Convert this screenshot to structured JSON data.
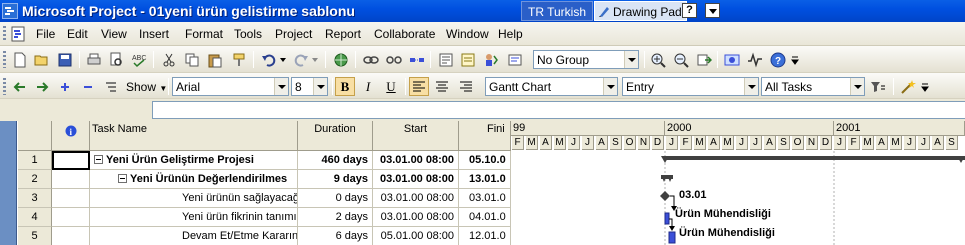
{
  "window": {
    "title": "Microsoft Project - 01yeni ürün gelistirme sablonu",
    "language_indicator": "TR Turkish",
    "drawing_pad": "Drawing Pad",
    "help_symbol": "?"
  },
  "menu": {
    "items": [
      {
        "name": "file",
        "label": "File"
      },
      {
        "name": "edit",
        "label": "Edit"
      },
      {
        "name": "view",
        "label": "View"
      },
      {
        "name": "insert",
        "label": "Insert"
      },
      {
        "name": "format",
        "label": "Format"
      },
      {
        "name": "tools",
        "label": "Tools"
      },
      {
        "name": "project",
        "label": "Project"
      },
      {
        "name": "report",
        "label": "Report"
      },
      {
        "name": "collaborate",
        "label": "Collaborate"
      },
      {
        "name": "window",
        "label": "Window"
      },
      {
        "name": "help",
        "label": "Help"
      }
    ]
  },
  "toolbar1": {
    "group_value": "No Group"
  },
  "toolbar2": {
    "show_label": "Show",
    "font_value": "Arial",
    "size_value": "8",
    "bold": "B",
    "italic": "I",
    "underline": "U",
    "view_value": "Gantt Chart",
    "table_value": "Entry",
    "filter_value": "All Tasks"
  },
  "grid": {
    "headers": {
      "info": "i",
      "task_name": "Task Name",
      "duration": "Duration",
      "start": "Start",
      "finish": "Fini"
    },
    "rows": [
      {
        "id": "1",
        "name": "Yeni Ürün Geliştirme Projesi",
        "duration": "460 days",
        "start": "03.01.00 08:00",
        "finish": "05.10.0",
        "bold": true,
        "indent": 0,
        "summary": true
      },
      {
        "id": "2",
        "name": "Yeni Ürünün Değerlendirilmes",
        "duration": "9 days",
        "start": "03.01.00 08:00",
        "finish": "13.01.0",
        "bold": true,
        "indent": 1,
        "summary": true
      },
      {
        "id": "3",
        "name": "Yeni ürünün sağlayacağı firs",
        "duration": "0 days",
        "start": "03.01.00 08:00",
        "finish": "03.01.0",
        "bold": false,
        "indent": 2,
        "summary": false
      },
      {
        "id": "4",
        "name": "Yeni ürün fikrinin tanımı",
        "duration": "2 days",
        "start": "03.01.00 08:00",
        "finish": "04.01.0",
        "bold": false,
        "indent": 2,
        "summary": false
      },
      {
        "id": "5",
        "name": "Devam Et/Etme  Kararının ver",
        "duration": "6 days",
        "start": "05.01.00 08:00",
        "finish": "12.01.0",
        "bold": false,
        "indent": 2,
        "summary": false
      }
    ]
  },
  "timescale": {
    "years": [
      "99",
      "2000",
      "2001"
    ],
    "months_1999": [
      "F",
      "M",
      "A",
      "M",
      "J",
      "J",
      "A",
      "S",
      "O",
      "N",
      "D"
    ],
    "months_2000": [
      "J",
      "F",
      "M",
      "A",
      "M",
      "J",
      "J",
      "A",
      "S",
      "O",
      "N",
      "D"
    ],
    "months_2001": [
      "J",
      "F",
      "M",
      "A",
      "M",
      "J",
      "J",
      "A",
      "S",
      "O",
      "N",
      "D"
    ]
  },
  "gantt": {
    "milestone_label": "03.01",
    "resource_label_row4": "Ürün Mühendisliği",
    "resource_label_row5": "Ürün Mühendisliği",
    "summary_color": "#404040",
    "task_color": "#3b4fd8"
  }
}
